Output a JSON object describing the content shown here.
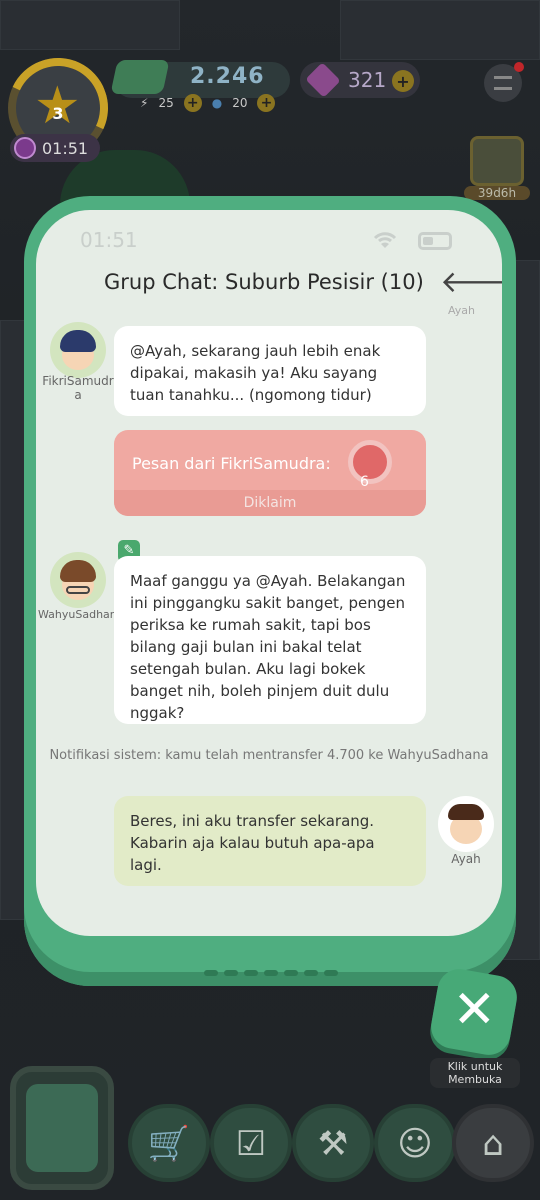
{
  "hud": {
    "level": "3",
    "timer": "01:51",
    "cash": "2.246",
    "energy": "25",
    "water": "20",
    "gems": "321",
    "event_timer": "39d6h"
  },
  "phone": {
    "clock": "01:51",
    "header_title": "Grup Chat: Suburb Pesisir (10)",
    "header_top_faint": "Ayah"
  },
  "chat": {
    "messages": [
      {
        "sender": "FikriSamudra",
        "sender_line1": "FikriSamudr",
        "sender_line2": "a",
        "text": "@Ayah, sekarang jauh lebih enak dipakai, makasih ya! Aku sayang tuan tanahku... (ngomong tidur)"
      },
      {
        "sender": "WahyuSadhana",
        "text": "Maaf ganggu ya @Ayah. Belakangan ini pinggangku sakit banget, pengen periksa ke rumah sakit, tapi bos bilang gaji bulan ini bakal telat setengah bulan. Aku lagi bokek banget nih, boleh pinjem duit dulu nggak?"
      },
      {
        "sender": "Ayah",
        "text": "Beres, ini aku transfer sekarang. Kabarin aja kalau butuh apa-apa lagi."
      }
    ],
    "gift": {
      "label": "Pesan dari FikriSamudra:",
      "status": "Diklaim",
      "amount": "6"
    },
    "system_note": "Notifikasi sistem: kamu telah mentransfer 4.700 ke WahyuSadhana"
  },
  "close_button": {
    "label": "Klik untuk Membuka"
  }
}
